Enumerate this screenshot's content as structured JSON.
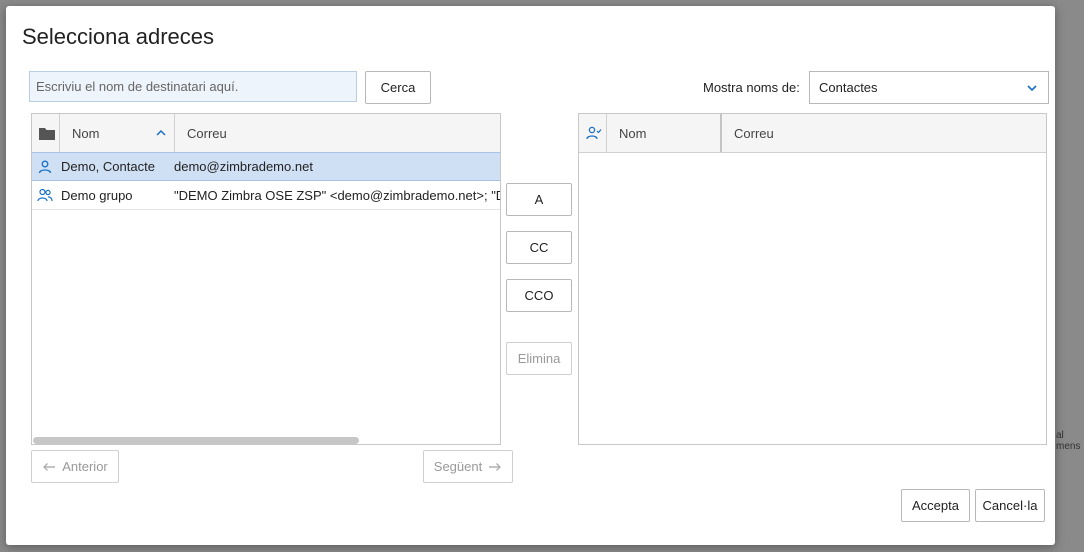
{
  "dialog": {
    "title": "Selecciona adreces",
    "search": {
      "placeholder": "Escriviu el nom de destinatari aquí.",
      "value": ""
    },
    "search_button": "Cerca",
    "show_names_label": "Mostra noms de:",
    "show_names_value": "Contactes"
  },
  "source_list": {
    "columns": [
      "Nom",
      "Correu"
    ],
    "rows": [
      {
        "name": "Demo, Contacte",
        "email": "demo@zimbrademo.net",
        "icon": "person-icon",
        "selected": true
      },
      {
        "name": "Demo grupo",
        "email": "\"DEMO Zimbra OSE ZSP\" <demo@zimbrademo.net>; \"De",
        "icon": "group-icon",
        "selected": false
      }
    ]
  },
  "action_buttons": {
    "to": "A",
    "cc": "CC",
    "bcc": "CCO",
    "remove": "Elimina"
  },
  "target_list": {
    "columns": [
      "Nom",
      "Correu"
    ],
    "rows": []
  },
  "pager": {
    "prev": "Anterior",
    "next": "Següent"
  },
  "footer": {
    "ok": "Accepta",
    "cancel": "Cancel·la"
  },
  "background_fragments": [
    "al mens"
  ],
  "colors": {
    "accent": "#1a6fc4",
    "selected_row": "#cfe0f5",
    "input_bg": "#eef4fb"
  }
}
